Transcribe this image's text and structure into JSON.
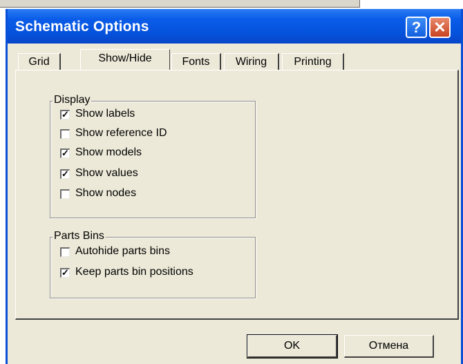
{
  "window": {
    "title": "Schematic Options",
    "help_glyph": "?",
    "close_glyph": "✕"
  },
  "tabs": [
    {
      "label": "Grid",
      "active": false
    },
    {
      "label": "Show/Hide",
      "active": true
    },
    {
      "label": "Fonts",
      "active": false
    },
    {
      "label": "Wiring",
      "active": false
    },
    {
      "label": "Printing",
      "active": false
    }
  ],
  "display_group": {
    "legend": "Display",
    "items": [
      {
        "label": "Show labels",
        "checked": true
      },
      {
        "label": "Show reference ID",
        "checked": false
      },
      {
        "label": "Show models",
        "checked": true
      },
      {
        "label": "Show values",
        "checked": true
      },
      {
        "label": "Show nodes",
        "checked": false
      }
    ]
  },
  "parts_bins_group": {
    "legend": "Parts Bins",
    "items": [
      {
        "label": "Autohide parts bins",
        "checked": false
      },
      {
        "label": "Keep parts bin positions",
        "checked": true
      }
    ]
  },
  "buttons": {
    "ok": "OK",
    "cancel": "Отмена"
  },
  "colors": {
    "titlebar": "#0552dc",
    "dialog_bg": "#ece9d8",
    "close_button": "#c8431f"
  }
}
